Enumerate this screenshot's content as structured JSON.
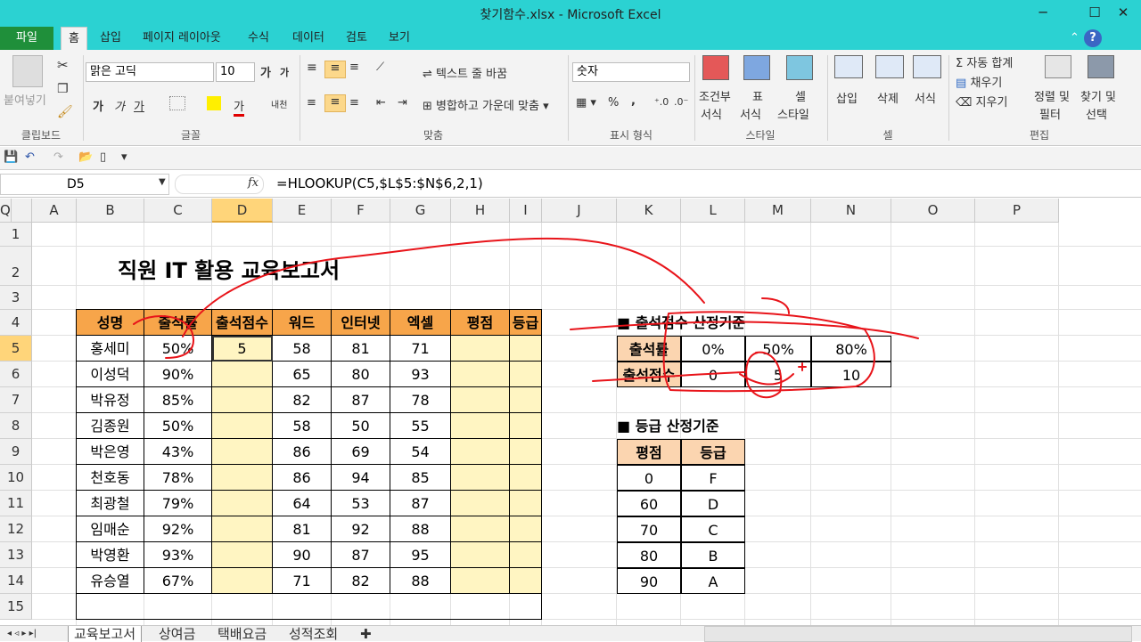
{
  "window": {
    "title": "찾기함수.xlsx - Microsoft Excel",
    "minimize": "─",
    "maximize": "☐",
    "close": "✕"
  },
  "tabs": {
    "file": "파일",
    "items": [
      "홈",
      "삽입",
      "페이지 레이아웃",
      "수식",
      "데이터",
      "검토",
      "보기"
    ]
  },
  "ribbon": {
    "paste": "붙여넣기",
    "clipboard_group": "클립보드",
    "font_name": "맑은 고딕",
    "font_size": "10",
    "font_grow": "가",
    "font_shrink": "가",
    "bold": "가",
    "italic": "가",
    "underline": "가",
    "font_color": "가",
    "phonetic": "내천",
    "font_group": "글꼴",
    "wrap_text": "텍스트 줄 바꿈",
    "merge_center": "병합하고 가운데 맞춤",
    "align_group": "맞춤",
    "number_format": "숫자",
    "percent": "%",
    "comma": ",",
    "number_group": "표시 형식",
    "cond_format_1": "조건부",
    "cond_format_2": "서식",
    "table_format_1": "표",
    "table_format_2": "서식",
    "cell_style_1": "셀",
    "cell_style_2": "스타일",
    "styles_group": "스타일",
    "insert": "삽입",
    "delete": "삭제",
    "format": "서식",
    "cells_group": "셀",
    "autosum": "Σ 자동 합계",
    "fill": "채우기",
    "clear": "지우기",
    "sort_1": "정렬 및",
    "sort_2": "필터",
    "find_1": "찾기 및",
    "find_2": "선택",
    "editing_group": "편집"
  },
  "formula_bar": {
    "name_box": "D5",
    "fx": "fx",
    "formula": "=HLOOKUP(C5,$L$5:$N$6,2,1)"
  },
  "columns": [
    "A",
    "B",
    "C",
    "D",
    "E",
    "F",
    "G",
    "H",
    "I",
    "J",
    "K",
    "L",
    "M",
    "N",
    "O",
    "P",
    "Q"
  ],
  "rows": [
    "1",
    "2",
    "3",
    "4",
    "5",
    "6",
    "7",
    "8",
    "9",
    "10",
    "11",
    "12",
    "13",
    "14",
    "15"
  ],
  "sheet": {
    "title": "직원 IT 활용 교육보고서",
    "headers": [
      "성명",
      "출석률",
      "출석점수",
      "워드",
      "인터넷",
      "엑셀",
      "평점",
      "등급"
    ],
    "data": [
      [
        "홍세미",
        "50%",
        "5",
        "58",
        "81",
        "71",
        "",
        ""
      ],
      [
        "이성덕",
        "90%",
        "",
        "65",
        "80",
        "93",
        "",
        ""
      ],
      [
        "박유정",
        "85%",
        "",
        "82",
        "87",
        "78",
        "",
        ""
      ],
      [
        "김종원",
        "50%",
        "",
        "58",
        "50",
        "55",
        "",
        ""
      ],
      [
        "박은영",
        "43%",
        "",
        "86",
        "69",
        "54",
        "",
        ""
      ],
      [
        "천호동",
        "78%",
        "",
        "86",
        "94",
        "85",
        "",
        ""
      ],
      [
        "최광철",
        "79%",
        "",
        "64",
        "53",
        "87",
        "",
        ""
      ],
      [
        "임매순",
        "92%",
        "",
        "81",
        "92",
        "88",
        "",
        ""
      ],
      [
        "박영환",
        "93%",
        "",
        "90",
        "87",
        "95",
        "",
        ""
      ],
      [
        "유승열",
        "67%",
        "",
        "71",
        "82",
        "88",
        "",
        ""
      ]
    ],
    "attendance_title": "■ 출석점수 산정기준",
    "attendance": {
      "row1_label": "출석률",
      "row1": [
        "0%",
        "50%",
        "80%"
      ],
      "row2_label": "출석점수",
      "row2": [
        "0",
        "5",
        "10"
      ]
    },
    "grade_title": "■ 등급 산정기준",
    "grade_headers": [
      "평점",
      "등급"
    ],
    "grades": [
      [
        "0",
        "F"
      ],
      [
        "60",
        "D"
      ],
      [
        "70",
        "C"
      ],
      [
        "80",
        "B"
      ],
      [
        "90",
        "A"
      ]
    ]
  },
  "sheet_tabs": [
    "교육보고서",
    "상여금",
    "택배요금",
    "성적조회"
  ],
  "colors": {
    "title_bar": "#2bd2d2",
    "file_tab": "#1f8f3a",
    "header_fill": "#f7a54a",
    "data_fill": "#fff5c2",
    "criteria_header": "#fbd5b0",
    "annotation": "#e8141a"
  }
}
